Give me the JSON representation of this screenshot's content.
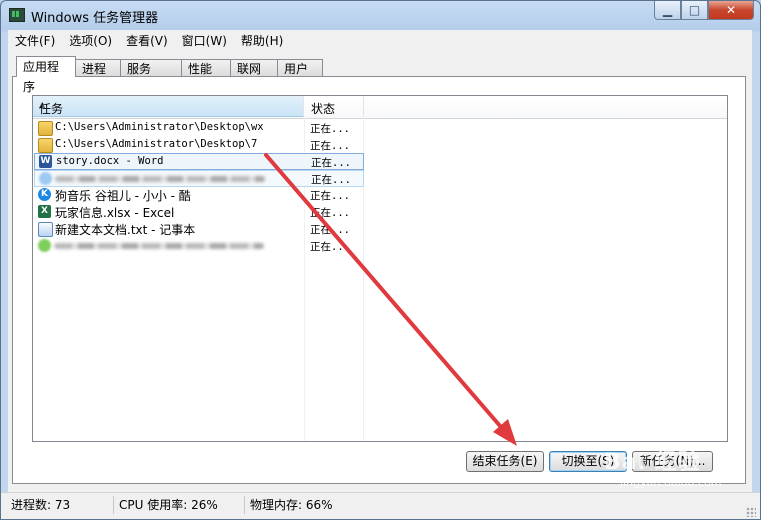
{
  "window": {
    "title": "Windows 任务管理器",
    "controls": {
      "minimize": "▁",
      "maximize": "□",
      "close": "✕"
    }
  },
  "menu": [
    "文件(F)",
    "选项(O)",
    "查看(V)",
    "窗口(W)",
    "帮助(H)"
  ],
  "tabs": [
    "应用程序",
    "进程",
    "服务",
    "性能",
    "联网",
    "用户"
  ],
  "active_tab": "应用程序",
  "columns": {
    "task": "任务",
    "status": "状态"
  },
  "rows": [
    {
      "icon": "folder-icon",
      "task": "C:\\Users\\Administrator\\Desktop\\wx",
      "status": "正在..."
    },
    {
      "icon": "folder-icon",
      "task": "C:\\Users\\Administrator\\Desktop\\7",
      "status": "正在..."
    },
    {
      "icon": "word-icon",
      "task": "story.docx - Word",
      "status": "正在...",
      "selected": true
    },
    {
      "icon": "blurred-app-icon",
      "task": "",
      "status": "正在...",
      "blurred": true
    },
    {
      "icon": "kugou-icon",
      "task": "狗音乐 谷祖儿 - 小小 - 酷",
      "status": "正在..."
    },
    {
      "icon": "excel-icon",
      "task": "玩家信息.xlsx - Excel",
      "status": "正在..."
    },
    {
      "icon": "notepad-icon",
      "task": "新建文本文档.txt - 记事本",
      "status": "正在..."
    },
    {
      "icon": "blurred-app-icon",
      "task": "",
      "status": "正在...",
      "blurred": true
    }
  ],
  "buttons": {
    "end_task": "结束任务(E)",
    "switch_to": "切换至(S)",
    "new_task": "新任务(N)..."
  },
  "statusbar": {
    "processes": "进程数: 73",
    "cpu": "CPU 使用率: 26%",
    "memory": "物理内存: 66%"
  },
  "annotation": {
    "type": "red-arrow",
    "points_to": "结束任务(E)",
    "color": "#e0393e"
  },
  "watermark": {
    "text": "Bai 经验",
    "sub": "jingyan.baidu.com"
  }
}
